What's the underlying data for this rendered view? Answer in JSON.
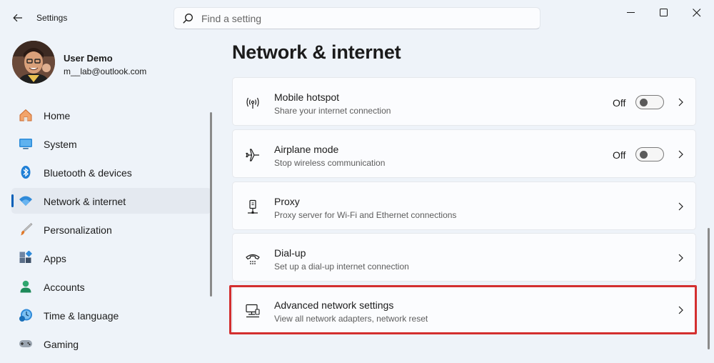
{
  "window": {
    "title": "Settings",
    "controls": [
      "minimize",
      "maximize",
      "close"
    ]
  },
  "search": {
    "placeholder": "Find a setting",
    "value": ""
  },
  "profile": {
    "name": "User Demo",
    "email": "m__lab@outlook.com"
  },
  "sidebar": {
    "items": [
      {
        "label": "Home",
        "icon": "home-icon",
        "selected": false
      },
      {
        "label": "System",
        "icon": "monitor-icon",
        "selected": false
      },
      {
        "label": "Bluetooth & devices",
        "icon": "bluetooth-icon",
        "selected": false
      },
      {
        "label": "Network & internet",
        "icon": "wifi-icon",
        "selected": true
      },
      {
        "label": "Personalization",
        "icon": "brush-icon",
        "selected": false
      },
      {
        "label": "Apps",
        "icon": "apps-icon",
        "selected": false
      },
      {
        "label": "Accounts",
        "icon": "person-icon",
        "selected": false
      },
      {
        "label": "Time & language",
        "icon": "clock-globe-icon",
        "selected": false
      },
      {
        "label": "Gaming",
        "icon": "gamepad-icon",
        "selected": false
      }
    ]
  },
  "main": {
    "title": "Network & internet",
    "cards": [
      {
        "title": "Mobile hotspot",
        "description": "Share your internet connection",
        "icon": "hotspot-icon",
        "toggle": {
          "state_label": "Off",
          "on": false
        }
      },
      {
        "title": "Airplane mode",
        "description": "Stop wireless communication",
        "icon": "airplane-icon",
        "toggle": {
          "state_label": "Off",
          "on": false
        }
      },
      {
        "title": "Proxy",
        "description": "Proxy server for Wi-Fi and Ethernet connections",
        "icon": "proxy-icon"
      },
      {
        "title": "Dial-up",
        "description": "Set up a dial-up internet connection",
        "icon": "phone-icon"
      },
      {
        "title": "Advanced network settings",
        "description": "View all network adapters, network reset",
        "icon": "network-pc-icon",
        "highlighted": true
      }
    ]
  },
  "colors": {
    "accent": "#005fb8",
    "highlight": "#d32f2f",
    "background": "#eef3f9"
  }
}
